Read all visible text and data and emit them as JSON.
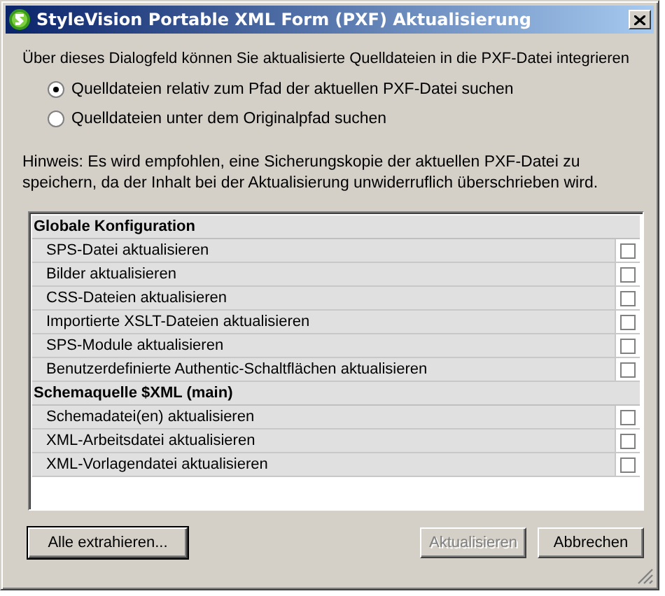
{
  "window": {
    "title": "StyleVision Portable XML Form (PXF) Aktualisierung"
  },
  "intro": "Über dieses Dialogfeld können Sie aktualisierte Quelldateien in die PXF-Datei integrieren",
  "radios": [
    {
      "label": "Quelldateien relativ zum Pfad der aktuellen PXF-Datei suchen",
      "selected": true
    },
    {
      "label": "Quelldateien unter dem Originalpfad suchen",
      "selected": false
    }
  ],
  "hint": "Hinweis: Es wird empfohlen, eine Sicherungskopie der aktuellen PXF-Datei zu speichern, da der Inhalt bei der Aktualisierung unwiderruflich überschrieben wird.",
  "groups": [
    {
      "title": "Globale Konfiguration",
      "items": [
        {
          "label": "SPS-Datei aktualisieren",
          "checked": false
        },
        {
          "label": "Bilder aktualisieren",
          "checked": false
        },
        {
          "label": "CSS-Dateien aktualisieren",
          "checked": false
        },
        {
          "label": "Importierte XSLT-Dateien aktualisieren",
          "checked": false
        },
        {
          "label": "SPS-Module aktualisieren",
          "checked": false
        },
        {
          "label": "Benutzerdefinierte Authentic-Schaltflächen aktualisieren",
          "checked": false
        }
      ]
    },
    {
      "title": "Schemaquelle $XML (main)",
      "items": [
        {
          "label": "Schemadatei(en) aktualisieren",
          "checked": false
        },
        {
          "label": "XML-Arbeitsdatei aktualisieren",
          "checked": false
        },
        {
          "label": "XML-Vorlagendatei aktualisieren",
          "checked": false
        }
      ]
    }
  ],
  "buttons": [
    {
      "label": "Alle extrahieren...",
      "disabled": false
    },
    {
      "label": "Aktualisieren",
      "disabled": true
    },
    {
      "label": "Abbrechen",
      "disabled": false
    }
  ]
}
